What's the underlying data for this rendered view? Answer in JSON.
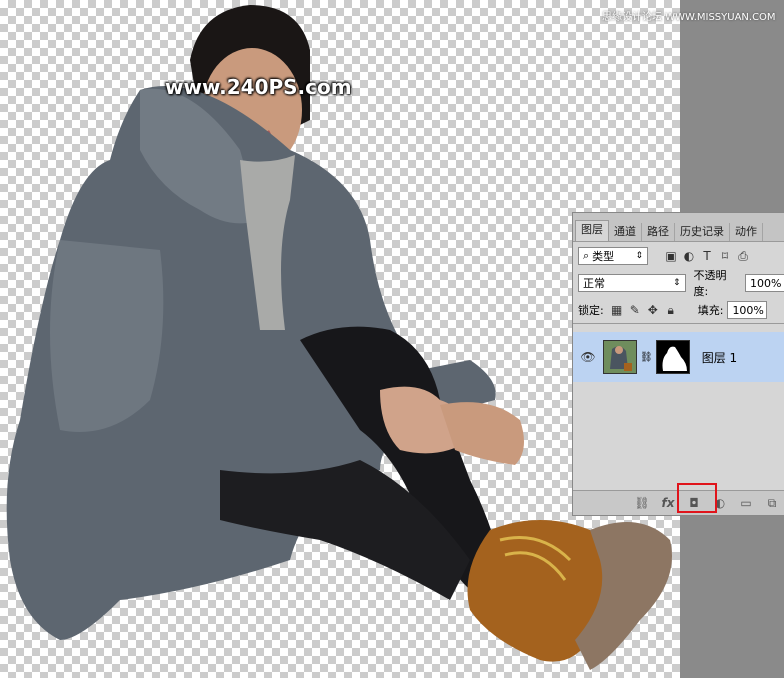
{
  "watermark": "www.240PS.com",
  "site_mark": "思缘设计论坛 WWW.MISSYUAN.COM",
  "panel": {
    "tabs": [
      "图层",
      "通道",
      "路径",
      "历史记录",
      "动作"
    ],
    "filter": {
      "icon": "search-icon",
      "label": "类型"
    },
    "blend_mode": "正常",
    "opacity_label": "不透明度:",
    "opacity_value": "100%",
    "lock_label": "锁定:",
    "fill_label": "填充:",
    "fill_value": "100%",
    "layers": [
      {
        "name": "图层 1",
        "visible": true,
        "has_mask": true,
        "selected": true
      }
    ],
    "bottom_icons": [
      "link-icon",
      "fx-icon",
      "add-mask-icon",
      "adjustment-icon",
      "folder-icon",
      "new-layer-icon"
    ],
    "fx_label": "fx"
  },
  "colors": {
    "highlight": "#e0141b",
    "selected_layer": "#bcd3f2",
    "pasteboard": "#8a8a8a"
  }
}
